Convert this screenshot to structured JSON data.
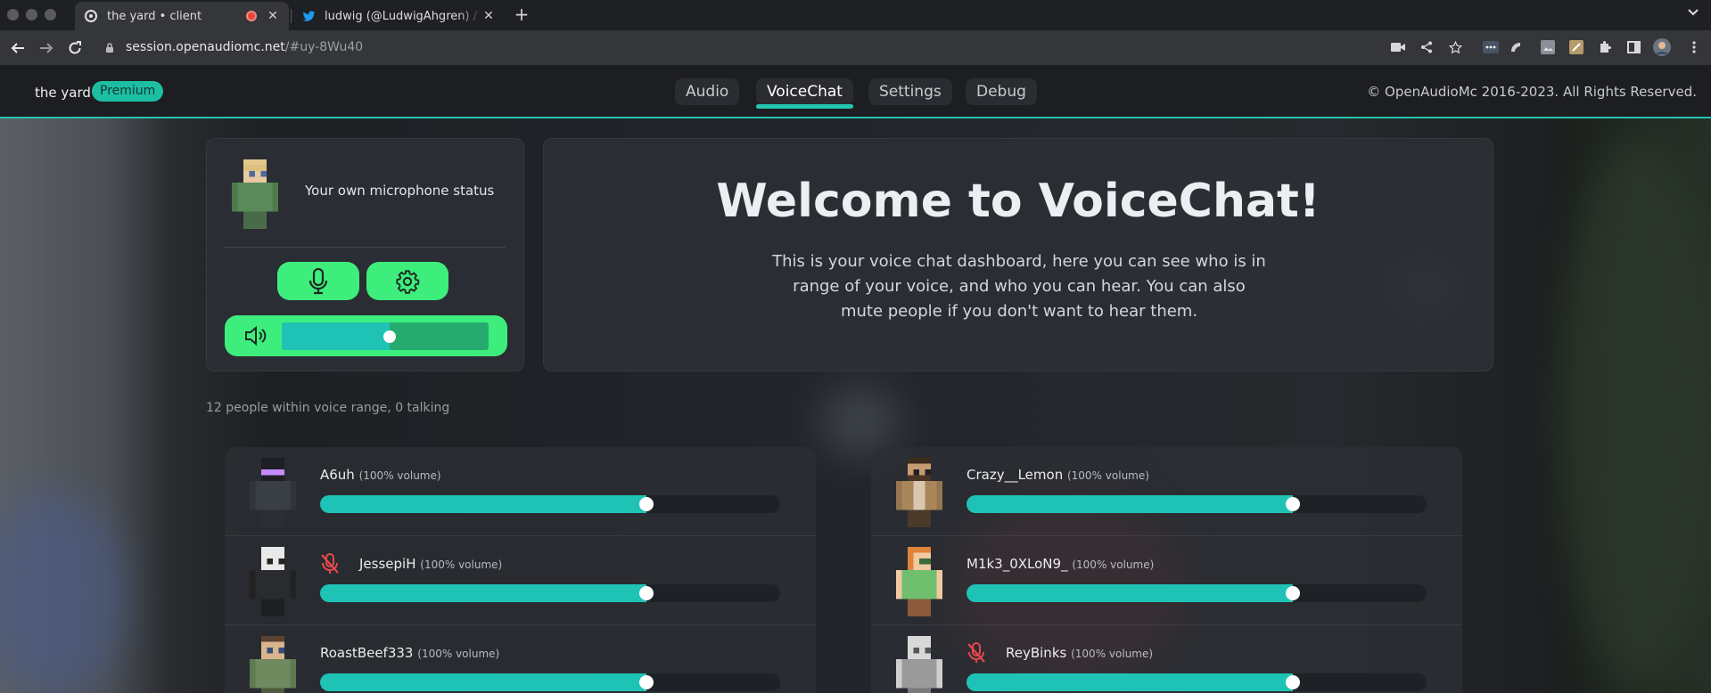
{
  "browser": {
    "tabs": [
      {
        "title": "the yard • client",
        "active": true,
        "recording": true
      },
      {
        "title": "ludwig (@LudwigAhgren) / Tw",
        "active": false,
        "recording": false
      }
    ],
    "url_domain": "session.openaudiomc.net",
    "url_path": "/#uy-8Wu40"
  },
  "app": {
    "server_name": "the yard",
    "badge": "Premium",
    "tabs": [
      "Audio",
      "VoiceChat",
      "Settings",
      "Debug"
    ],
    "active_tab": "VoiceChat",
    "copyright": "© OpenAudioMc 2016-2023. All Rights Reserved."
  },
  "mic_card": {
    "status_label": "Your own microphone status",
    "volume_level": 0.52
  },
  "welcome": {
    "title": "Welcome to VoiceChat!",
    "text": "This is your voice chat dashboard, here you can see who is in range of your voice, and who you can hear. You can also mute people if you don't want to hear them."
  },
  "range_text": "12 people within voice range, 0 talking",
  "people_left": [
    {
      "name": "A6uh",
      "volume_label": "(100% volume)",
      "muted": false,
      "level": 0.71
    },
    {
      "name": "JessepiH",
      "volume_label": "(100% volume)",
      "muted": true,
      "level": 0.71
    },
    {
      "name": "RoastBeef333",
      "volume_label": "(100% volume)",
      "muted": false,
      "level": 0.71
    }
  ],
  "people_right": [
    {
      "name": "Crazy__Lemon",
      "volume_label": "(100% volume)",
      "muted": false,
      "level": 0.71
    },
    {
      "name": "M1k3_0XLoN9_",
      "volume_label": "(100% volume)",
      "muted": false,
      "level": 0.71
    },
    {
      "name": "ReyBinks",
      "volume_label": "(100% volume)",
      "muted": true,
      "level": 0.71
    }
  ],
  "colors": {
    "accent": "#23c6ae",
    "green": "#3eee7c",
    "slider_fill": "#1fc3b5"
  }
}
